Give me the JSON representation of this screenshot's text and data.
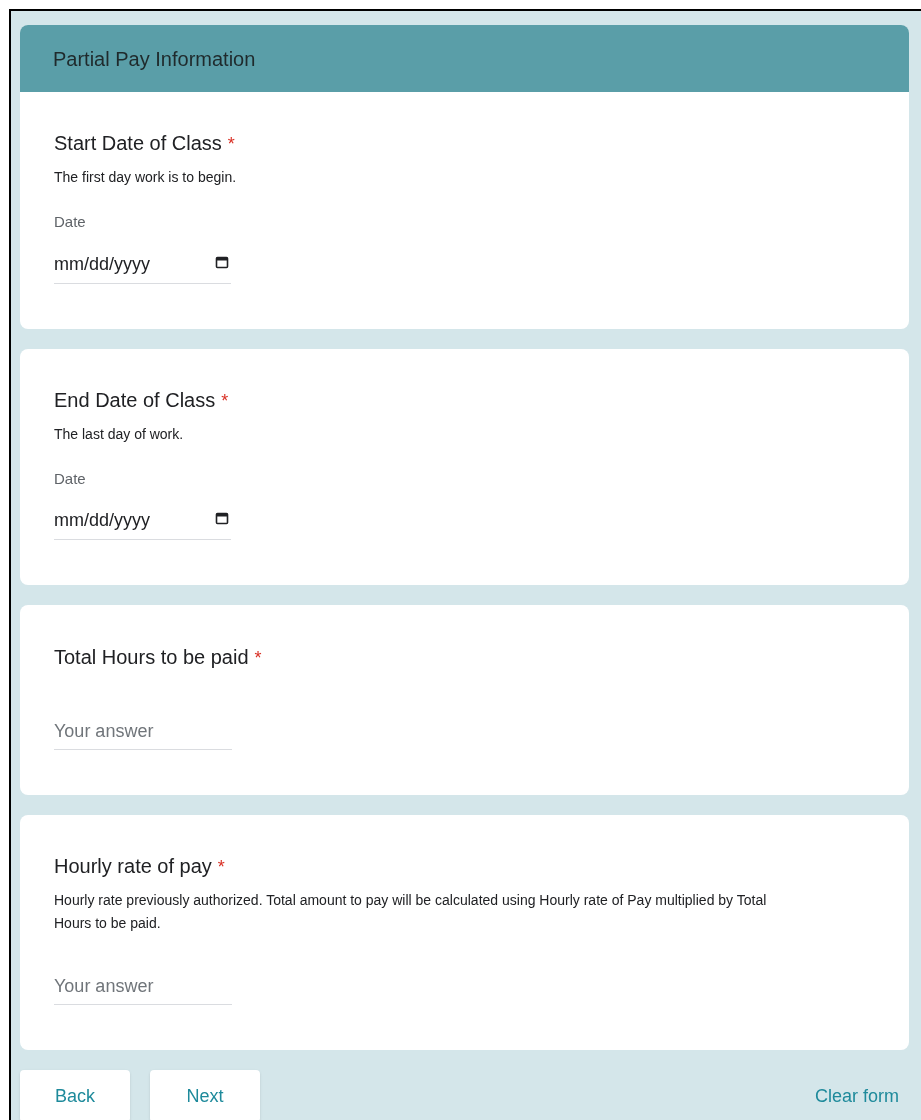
{
  "section": {
    "title": "Partial Pay Information"
  },
  "questions": [
    {
      "kind": "date",
      "title": "Start Date of Class",
      "required_mark": "*",
      "description": "The first day work is to begin.",
      "field_label": "Date",
      "placeholder": "mm/dd/yyyy"
    },
    {
      "kind": "date",
      "title": "End Date of Class",
      "required_mark": "*",
      "description": "The last day of work.",
      "field_label": "Date",
      "placeholder": "mm/dd/yyyy"
    },
    {
      "kind": "text",
      "title": "Total Hours to be paid",
      "required_mark": "*",
      "placeholder": "Your answer"
    },
    {
      "kind": "text",
      "title": "Hourly rate of pay",
      "required_mark": "*",
      "description": "Hourly rate previously authorized. Total amount to pay will be calculated using Hourly rate of Pay multiplied by Total Hours to be paid.",
      "placeholder": "Your answer"
    }
  ],
  "buttons": [
    "Back",
    "Next"
  ],
  "clear_link": "Clear form"
}
